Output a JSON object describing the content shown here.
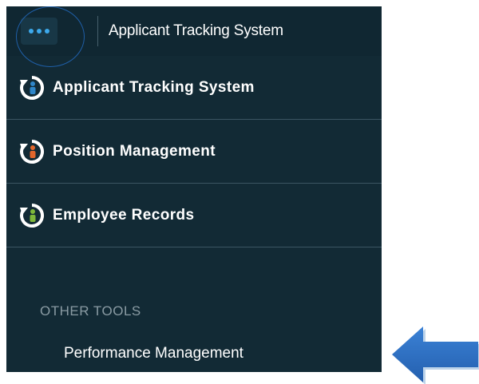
{
  "header": {
    "title": "Applicant Tracking System",
    "menu_icon": "more-dots-icon"
  },
  "nav": {
    "items": [
      {
        "label": "Applicant Tracking System",
        "icon": "refresh-person-icon",
        "accent": "#2f86c9"
      },
      {
        "label": "Position Management",
        "icon": "refresh-person-icon",
        "accent": "#e2662b"
      },
      {
        "label": "Employee Records",
        "icon": "refresh-person-icon",
        "accent": "#7fb83a"
      }
    ]
  },
  "other_tools": {
    "heading": "OTHER TOOLS",
    "items": [
      {
        "label": "Performance Management"
      }
    ]
  },
  "colors": {
    "panel_bg": "#122a35",
    "arrow": "#2c6fc4"
  }
}
